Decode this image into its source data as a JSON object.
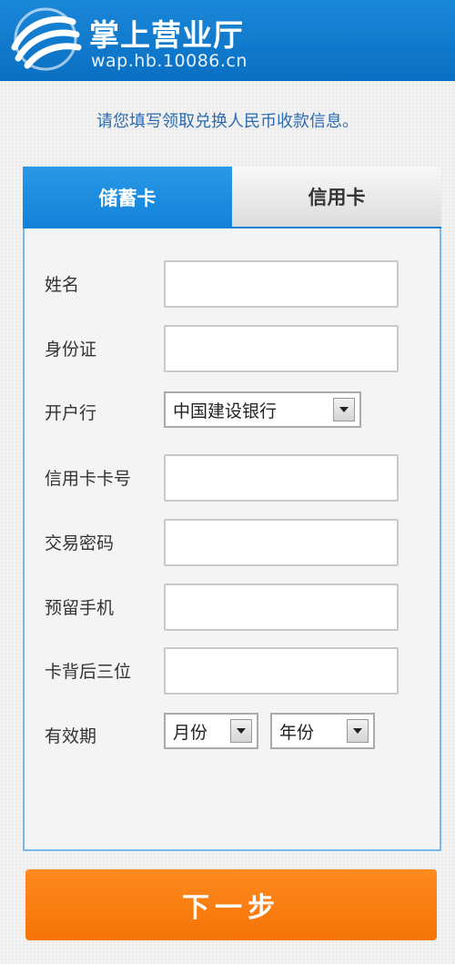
{
  "header": {
    "title": "掌上营业厅",
    "url": "wap.hb.10086.cn",
    "logo_icon": "china-mobile-logo-icon"
  },
  "notice": "请您填写领取兑换人民币收款信息。",
  "tabs": [
    {
      "label": "储蓄卡",
      "active": true
    },
    {
      "label": "信用卡",
      "active": false
    }
  ],
  "form": {
    "name_label": "姓名",
    "name_value": "",
    "id_label": "身份证",
    "id_value": "",
    "bank_label": "开户行",
    "bank_selected": "中国建设银行",
    "card_label": "信用卡卡号",
    "card_value": "",
    "password_label": "交易密码",
    "password_value": "",
    "phone_label": "预留手机",
    "phone_value": "",
    "cvv_label": "卡背后三位",
    "cvv_value": "",
    "expiry_label": "有效期",
    "month_selected": "月份",
    "year_selected": "年份"
  },
  "next_button": "下一步",
  "colors": {
    "header_blue": "#0a6fc2",
    "tab_active": "#1282d9",
    "notice_text": "#2a6bb3",
    "button_orange": "#f47306"
  }
}
